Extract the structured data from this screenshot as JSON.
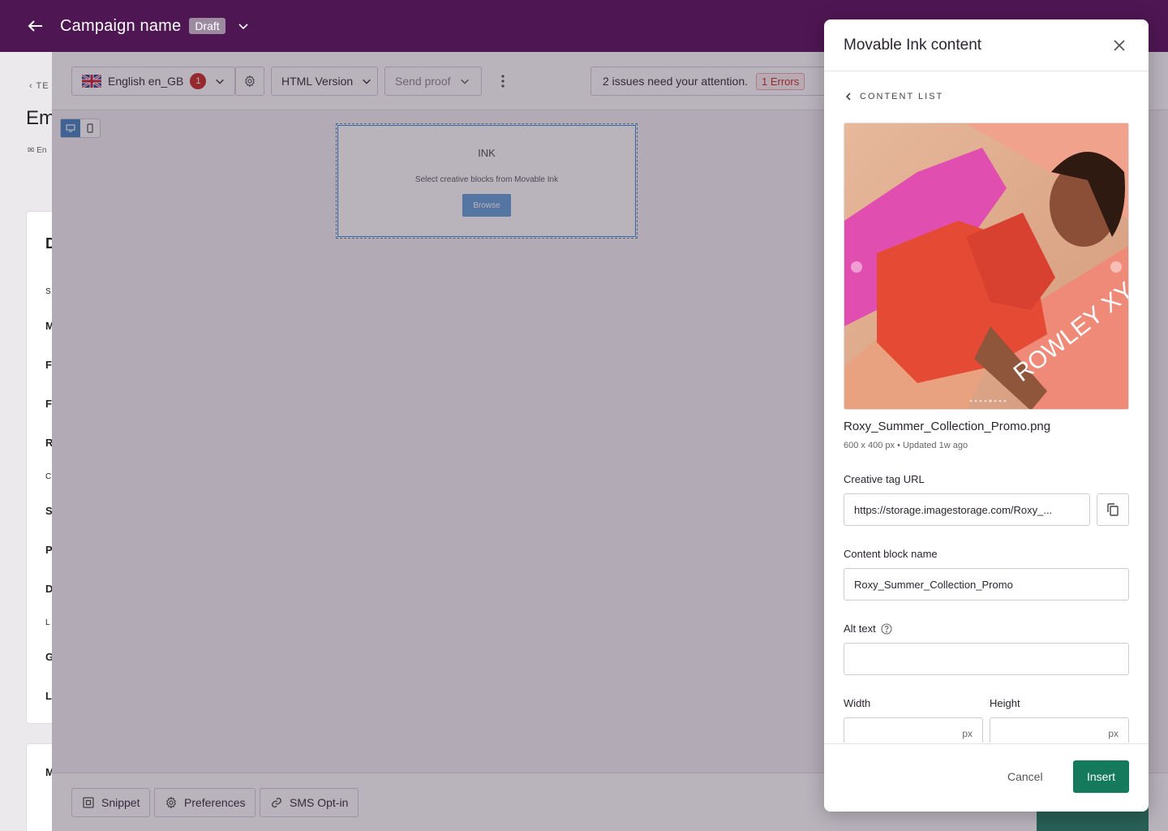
{
  "topbar": {
    "title": "Campaign name",
    "status_badge": "Draft"
  },
  "background": {
    "breadcrumb": "TE",
    "heading": "Em",
    "envelope_label": "En",
    "list_letters": [
      "D",
      "S",
      "M",
      "F",
      "F",
      "R",
      "C",
      "S",
      "P",
      "D",
      "L",
      "G",
      "L"
    ],
    "card2_letter": "M"
  },
  "toolbar": {
    "language": "English en_GB",
    "language_errors": "1",
    "version": "HTML Version",
    "send_proof": "Send proof",
    "issues_text": "2 issues need your attention.",
    "errors_label": "1 Errors"
  },
  "canvas": {
    "block_title": "INK",
    "block_subtitle": "Select creative blocks from Movable Ink",
    "browse_label": "Browse"
  },
  "footer": {
    "snippet": "Snippet",
    "preferences": "Preferences",
    "sms_optin": "SMS Opt-in"
  },
  "modal": {
    "title": "Movable Ink content",
    "back_label": "CONTENT LIST",
    "image_caption_text": "ROWLEY XY",
    "file_name": "Roxy_Summer_Collection_Promo.png",
    "file_meta": "600 x 400 px • Updated 1w ago",
    "creative_tag_label": "Creative tag URL",
    "creative_tag_value": "https://storage.imagestorage.com/Roxy_...",
    "block_name_label": "Content block name",
    "block_name_value": "Roxy_Summer_Collection_Promo",
    "alt_text_label": "Alt text",
    "alt_text_value": "",
    "width_label": "Width",
    "height_label": "Height",
    "width_unit": "px",
    "height_unit": "px",
    "cancel": "Cancel",
    "insert": "Insert"
  },
  "colors": {
    "topbar": "#4f1654",
    "primary_green": "#157a5c",
    "error_red": "#c4221a",
    "selection_blue": "#3a7fc1"
  }
}
